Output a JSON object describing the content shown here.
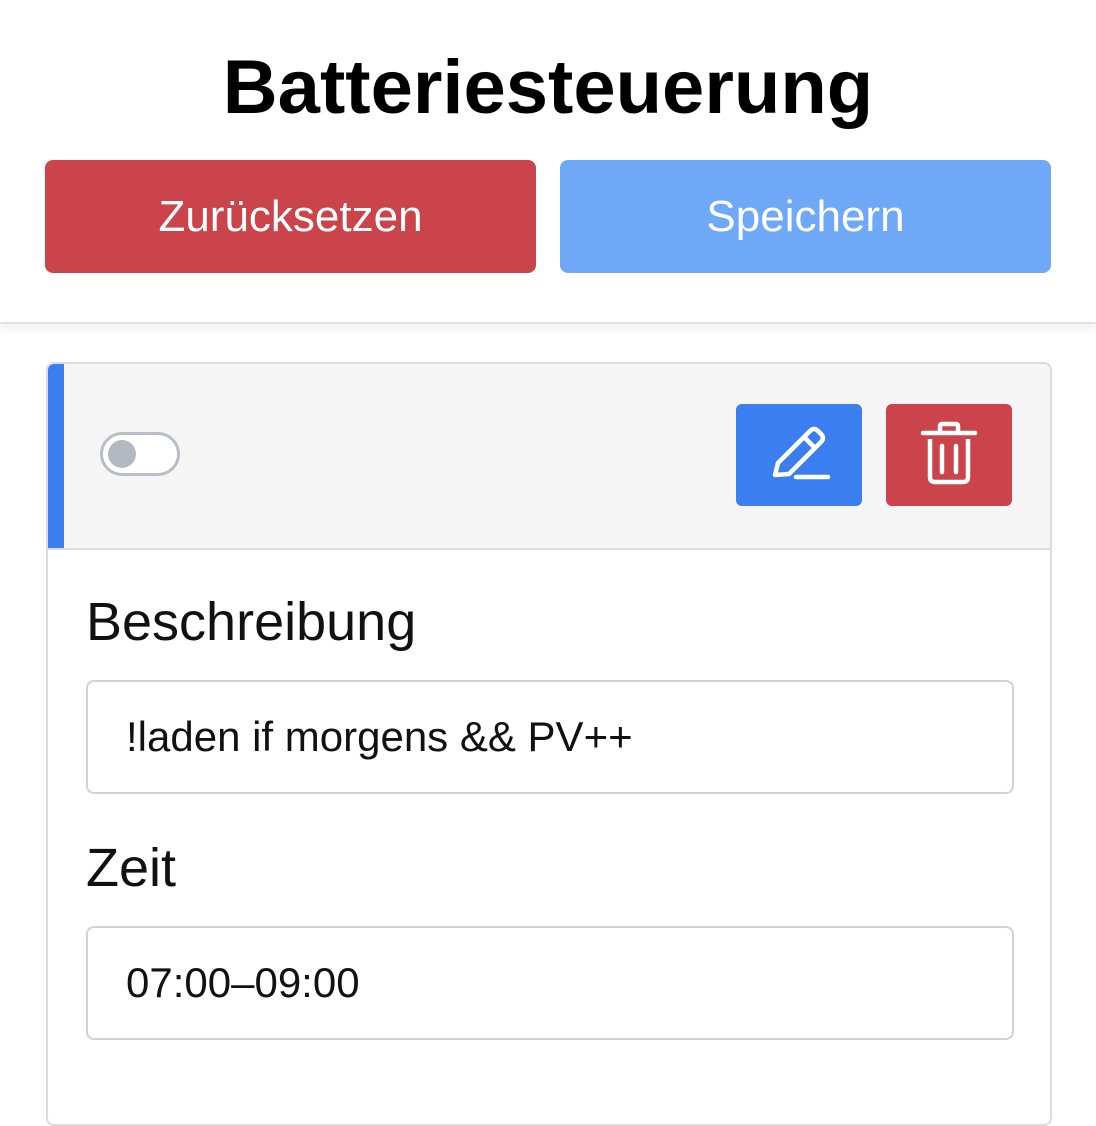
{
  "header": {
    "title": "Batteriesteuerung",
    "reset_label": "Zurücksetzen",
    "save_label": "Speichern"
  },
  "rule": {
    "enabled": false,
    "accent_color": "#3a7ef0",
    "actions": {
      "edit_icon": "pencil-icon",
      "delete_icon": "trash-icon"
    },
    "fields": {
      "description_label": "Beschreibung",
      "description_value": "!laden if morgens && PV++",
      "time_label": "Zeit",
      "time_value": "07:00–09:00"
    }
  },
  "colors": {
    "danger": "#cb444b",
    "primary": "#3a7ef0",
    "primary_light": "#6ea8f6"
  }
}
